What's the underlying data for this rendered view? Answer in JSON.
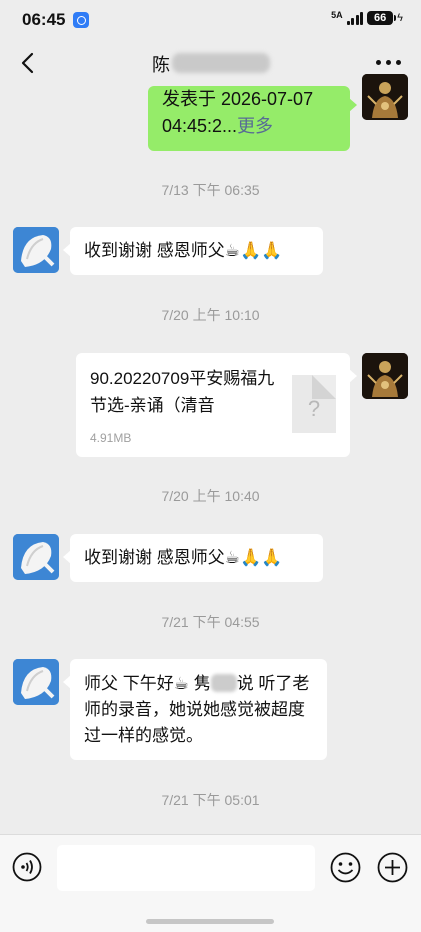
{
  "status_bar": {
    "time": "06:45",
    "signal_label": "5A",
    "battery": "66"
  },
  "header": {
    "title": "陈"
  },
  "messages": {
    "m1": {
      "line1": "发表于 2026-07-07",
      "line2": "04:45:2...",
      "more": "更多"
    },
    "t1": "7/13 下午 06:35",
    "m2": {
      "text": "收到谢谢 感恩师父☕🙏🙏"
    },
    "t2": "7/20 上午 10:10",
    "m3": {
      "title": "90.20220709平安赐福九节选-亲诵（清音",
      "size": "4.91MB",
      "icon": "?"
    },
    "t3": "7/20 上午 10:40",
    "m4": {
      "text": "收到谢谢 感恩师父☕🙏🙏"
    },
    "t4": "7/21 下午 04:55",
    "m5": {
      "part1": "师父 下午好☕ 隽",
      "part2": "说 听了老师的录音，她说她感觉被超度过一样的感觉。"
    },
    "t5": "7/21 下午 05:01"
  },
  "input": {
    "placeholder": ""
  },
  "icons": [
    "back-icon",
    "more-icon",
    "voice-icon",
    "emoji-icon",
    "add-icon",
    "file-unknown-icon"
  ],
  "colors": {
    "bubble_self": "#95ec69",
    "link": "#576b95",
    "background": "#ededed"
  }
}
